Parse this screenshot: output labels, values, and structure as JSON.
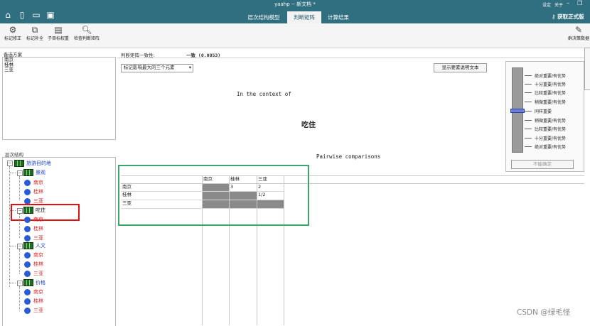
{
  "app": {
    "title": "yaahp -- 新文档 *",
    "tabs": [
      {
        "label": "层次结构模型",
        "active": false
      },
      {
        "label": "判断矩阵",
        "active": true
      },
      {
        "label": "计算结果",
        "active": false
      }
    ],
    "top_links": {
      "register": "设定",
      "about": "关于"
    },
    "license_label": "获取正式版",
    "accent": "#2f6f80"
  },
  "toolbar": {
    "items": [
      {
        "label": "标记修正",
        "icon": "adjust-icon"
      },
      {
        "label": "标记补全",
        "icon": "complete-icon"
      },
      {
        "label": "子目标权重",
        "icon": "subgoal-weight-icon"
      },
      {
        "label": "检查判断矩阵",
        "icon": "check-matrix-icon"
      }
    ],
    "right_item": "群决策数据"
  },
  "alternatives": {
    "header": "备选方案",
    "items": [
      "南京",
      "桂林",
      "三亚"
    ]
  },
  "hierarchy": {
    "header": "层次结构",
    "root": "旅游目的地",
    "criteria": [
      {
        "label": "景观",
        "children": [
          "南京",
          "桂林",
          "三亚"
        ]
      },
      {
        "label": "吃住",
        "children": [
          "南京",
          "桂林",
          "三亚"
        ],
        "highlighted": true
      },
      {
        "label": "人文",
        "children": [
          "南京",
          "桂林",
          "三亚"
        ]
      },
      {
        "label": "价格",
        "children": [
          "南京",
          "桂林",
          "三亚"
        ]
      }
    ]
  },
  "matrix": {
    "consistency_label": "判断矩阵一致性:",
    "consistency_value": "一致 (0.0053)",
    "dropdown_value": "标记影响最大的三个元素",
    "show_desc_button": "显示要素说明文本",
    "context_text": "In the context of",
    "context_node": "吃住",
    "pairwise_text": "Pairwise comparisons",
    "columns": [
      "南京",
      "桂林",
      "三亚"
    ],
    "rows": [
      {
        "label": "南京",
        "values": [
          "",
          "3",
          "2"
        ]
      },
      {
        "label": "桂林",
        "values": [
          "",
          "",
          "1/2"
        ]
      },
      {
        "label": "三亚",
        "values": [
          "",
          "",
          ""
        ]
      }
    ]
  },
  "scale": {
    "labels": [
      "绝对重要/有优势",
      "十分重要/有优势",
      "比较重要/有优势",
      "稍微重要/有优势",
      "同样重要",
      "稍微重要/有优势",
      "比较重要/有优势",
      "十分重要/有优势",
      "绝对重要/有优势"
    ],
    "confirm_button": "不能确定"
  },
  "watermark": "CSDN @绿毛怪"
}
